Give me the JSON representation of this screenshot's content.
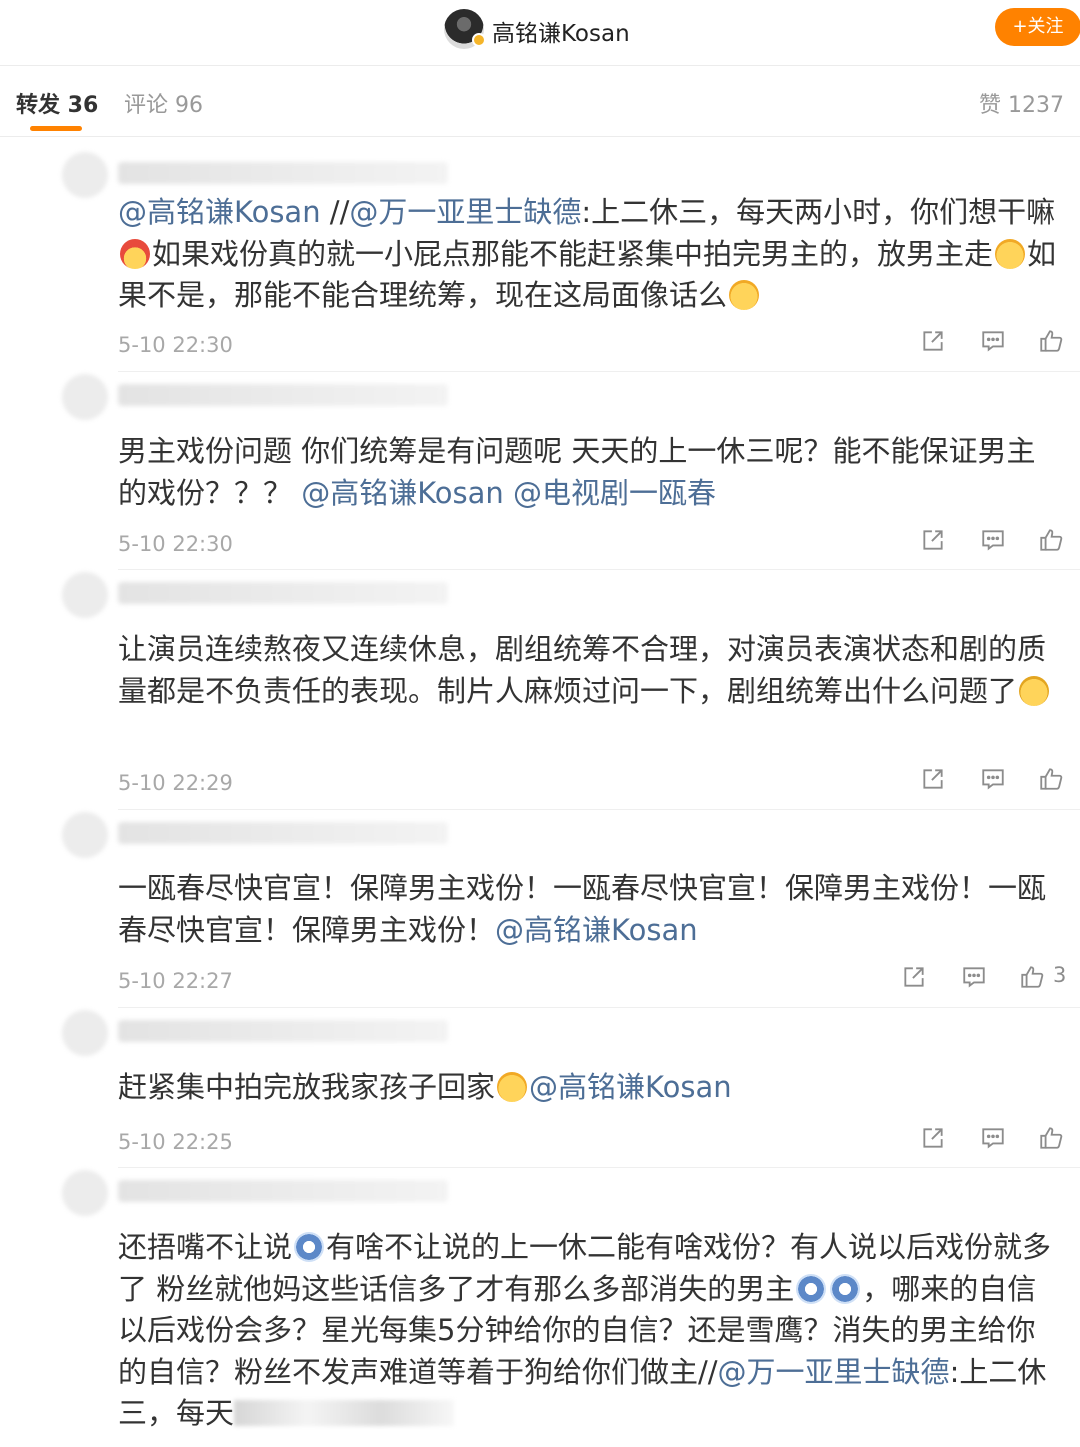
{
  "header": {
    "user_name": "高铭谦Kosan",
    "follow_label": "+关注",
    "avatar": "avatar",
    "verify_icon": "verified-badge-icon"
  },
  "tabs": [
    {
      "label": "转发 36",
      "active": true
    },
    {
      "label": "评论 96",
      "active": false
    },
    {
      "label": "赞 1237",
      "active": false
    }
  ],
  "colors": {
    "accent": "#ff8200",
    "mention": "#4d6e96",
    "time": "#a8a8a8"
  },
  "comments": [
    {
      "segments": [
        {
          "t": "@高铭谦Kosan",
          "m": true
        },
        {
          "t": " //"
        },
        {
          "t": "@万一亚里士缺德",
          "m": true
        },
        {
          "t": ":上二休三，每天两小时，你们想干嘛"
        },
        {
          "e": "santa"
        },
        {
          "t": "如果戏份真的就一小屁点那能不能赶紧集中拍完男主的，放男主走"
        },
        {
          "e": "smile"
        },
        {
          "t": "如果不是，那能不能合理统筹，现在这局面像话么"
        },
        {
          "e": "smile"
        }
      ],
      "time": "5-10 22:30",
      "likes": ""
    },
    {
      "segments": [
        {
          "t": "男主戏份问题 你们统筹是有问题呢 天天的上一休三呢？能不能保证男主的戏份？？？ "
        },
        {
          "t": "@高铭谦Kosan",
          "m": true
        },
        {
          "t": " "
        },
        {
          "t": "@电视剧一瓯春",
          "m": true
        }
      ],
      "time": "5-10 22:30",
      "likes": ""
    },
    {
      "segments": [
        {
          "t": "让演员连续熬夜又连续休息，剧组统筹不合理，对演员表演状态和剧的质量都是不负责任的表现。制片人麻烦过问一下，剧组统筹出什么问题了"
        },
        {
          "e": "think"
        }
      ],
      "time": "5-10 22:29",
      "likes": ""
    },
    {
      "segments": [
        {
          "t": "一瓯春尽快官宣！保障男主戏份！一瓯春尽快官宣！保障男主戏份！一瓯春尽快官宣！保障男主戏份！"
        },
        {
          "t": "@高铭谦Kosan",
          "m": true
        }
      ],
      "time": "5-10 22:27",
      "likes": "3"
    },
    {
      "segments": [
        {
          "t": "赶紧集中拍完放我家孩子回家"
        },
        {
          "e": "smile"
        },
        {
          "t": "@高铭谦Kosan",
          "m": true
        }
      ],
      "time": "5-10 22:25",
      "likes": ""
    },
    {
      "segments": [
        {
          "t": "还捂嘴不让说"
        },
        {
          "e": "shock"
        },
        {
          "t": "有啥不让说的上一休二能有啥戏份？有人说以后戏份就多了 粉丝就他妈这些话信多了才有那么多部消失的男主"
        },
        {
          "e": "shock"
        },
        {
          "e": "shock"
        },
        {
          "t": "，哪来的自信以后戏份会多？星光每集5分钟给你的自信？还是雪鹰？消失的男主给你的自信？粉丝不发声难道等着于狗给你们做主//"
        },
        {
          "t": "@万一亚里士缺德",
          "m": true
        },
        {
          "t": ":上二休三，每天"
        },
        {
          "r": true
        }
      ],
      "time": "",
      "likes": ""
    }
  ]
}
